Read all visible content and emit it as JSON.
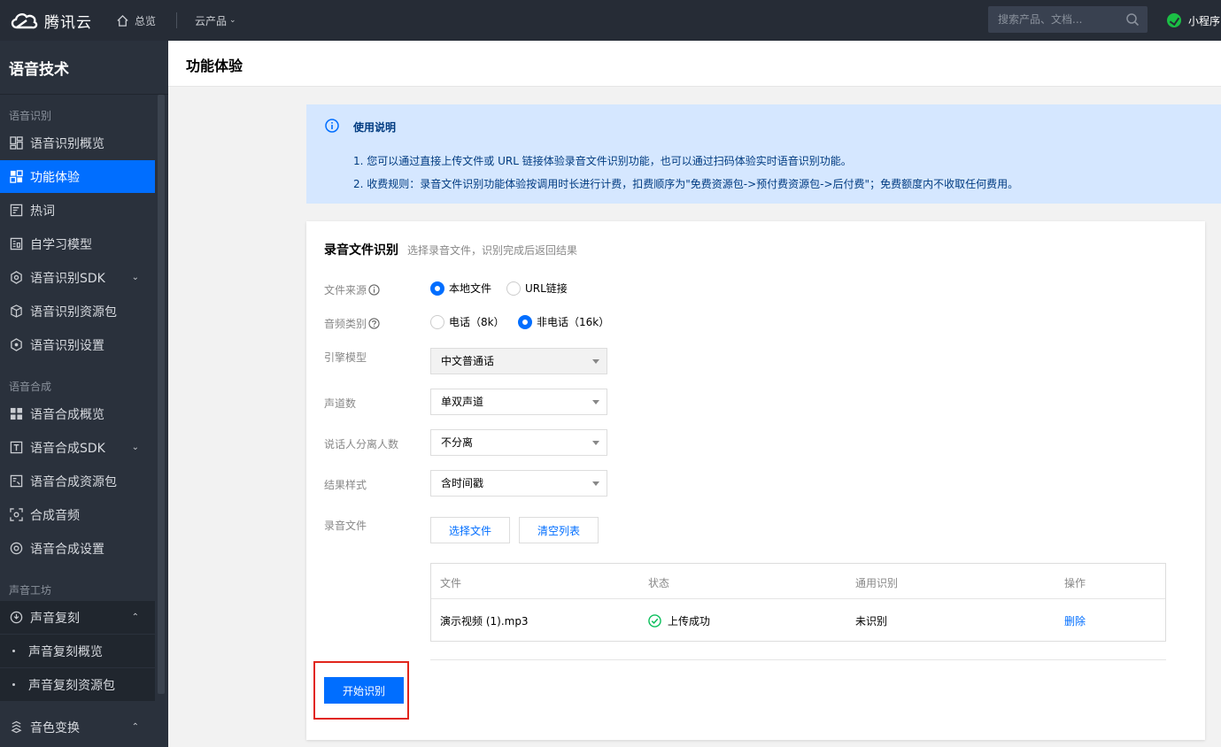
{
  "topbar": {
    "brand": "腾讯云",
    "home_label": "总览",
    "products_label": "云产品",
    "search_placeholder": "搜索产品、文档...",
    "miniapp_label": "小程序"
  },
  "sidebar": {
    "title": "语音技术",
    "groups": [
      {
        "label": "语音识别",
        "items": [
          {
            "label": "语音识别概览",
            "icon": "dashboard-icon"
          },
          {
            "label": "功能体验",
            "icon": "grid-icon",
            "active": true
          },
          {
            "label": "热词",
            "icon": "hotword-icon"
          },
          {
            "label": "自学习模型",
            "icon": "model-icon"
          },
          {
            "label": "语音识别SDK",
            "icon": "sdk-icon",
            "expandable": true
          },
          {
            "label": "语音识别资源包",
            "icon": "package-icon"
          },
          {
            "label": "语音识别设置",
            "icon": "settings-icon"
          }
        ]
      },
      {
        "label": "语音合成",
        "items": [
          {
            "label": "语音合成概览",
            "icon": "dashboard-icon"
          },
          {
            "label": "语音合成SDK",
            "icon": "text-sdk-icon",
            "expandable": true
          },
          {
            "label": "语音合成资源包",
            "icon": "package-icon"
          },
          {
            "label": "合成音频",
            "icon": "audio-icon"
          },
          {
            "label": "语音合成设置",
            "icon": "settings-icon"
          }
        ]
      },
      {
        "label": "声音工坊",
        "items": [
          {
            "label": "声音复刻",
            "icon": "clone-icon",
            "expanded": true
          },
          {
            "label": "声音复刻概览",
            "sub": true
          },
          {
            "label": "声音复刻资源包",
            "sub": true
          },
          {
            "label": "音色变换",
            "icon": "voice-change-icon",
            "expanded": true
          }
        ]
      }
    ]
  },
  "page": {
    "title": "功能体验"
  },
  "notice": {
    "title": "使用说明",
    "lines": [
      "1. 您可以通过直接上传文件或 URL 链接体验录音文件识别功能，也可以通过扫码体验实时语音识别功能。",
      "2. 收费规则：录音文件识别功能体验按调用时长进行计费，扣费顺序为\"免费资源包->预付费资源包->后付费\"；免费额度内不收取任何费用。"
    ]
  },
  "card": {
    "title": "录音文件识别",
    "subtitle": "选择录音文件，识别完成后返回结果",
    "source": {
      "label": "文件来源",
      "options": [
        {
          "label": "本地文件",
          "checked": true
        },
        {
          "label": "URL链接",
          "checked": false
        }
      ]
    },
    "audio_type": {
      "label": "音频类别",
      "options": [
        {
          "label": "电话（8k）",
          "checked": false
        },
        {
          "label": "非电话（16k）",
          "checked": true
        }
      ]
    },
    "engine": {
      "label": "引擎模型",
      "value": "中文普通话",
      "disabled": true
    },
    "channels": {
      "label": "声道数",
      "value": "单双声道"
    },
    "speakers": {
      "label": "说话人分离人数",
      "value": "不分离"
    },
    "result_style": {
      "label": "结果样式",
      "value": "含时间戳"
    },
    "file": {
      "label": "录音文件",
      "choose_button": "选择文件",
      "clear_button": "清空列表"
    },
    "table": {
      "columns": [
        "文件",
        "状态",
        "通用识别",
        "操作"
      ],
      "rows": [
        {
          "file": "演示视频 (1).mp3",
          "status": "上传成功",
          "recognition": "未识别",
          "action": "删除"
        }
      ]
    },
    "start_button": "开始识别"
  },
  "colors": {
    "topbar": "#262c36",
    "sidebar": "#2a313c",
    "accent": "#006eff",
    "notice_bg": "#d5e7ff",
    "success": "#0abf5b",
    "highlight": "#e1251b"
  }
}
